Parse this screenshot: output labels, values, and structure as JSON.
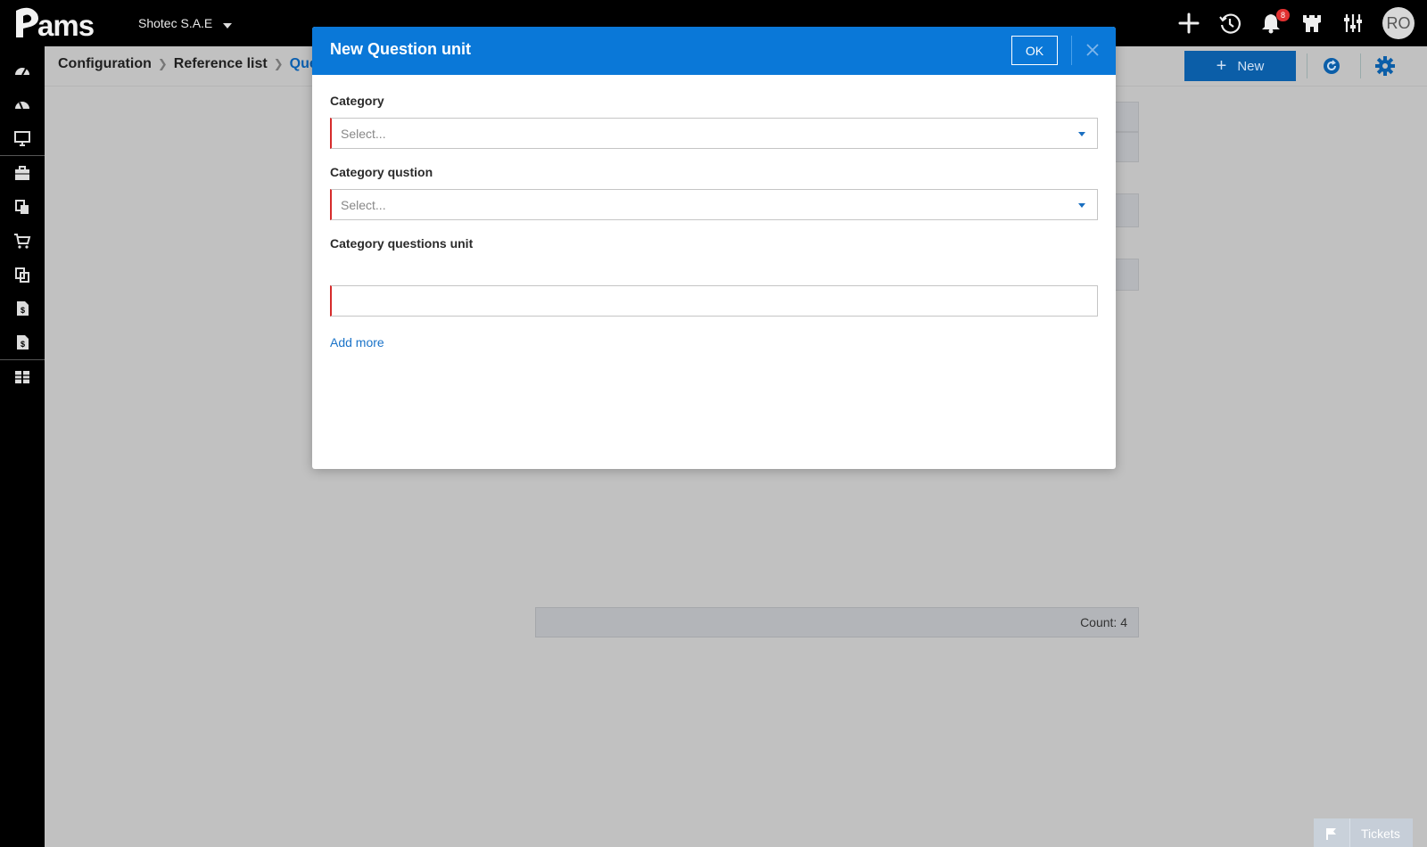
{
  "app": {
    "tenant": "Shotec S.A.E",
    "notification_count": "8",
    "avatar_initials": "RO",
    "accent_color": "#0a78d8"
  },
  "header_icons": [
    "plus-icon",
    "history-icon",
    "bell-icon",
    "castle-icon",
    "sliders-icon"
  ],
  "sidebar": {
    "items": [
      "dashboard-icon",
      "gauge-icon",
      "monitor-icon",
      "briefcase-icon",
      "documents-icon",
      "cart-icon",
      "copy-icon",
      "invoice-icon",
      "invoice-alt-icon",
      "grid-icon"
    ]
  },
  "breadcrumb": {
    "items": [
      "Configuration",
      "Reference list"
    ],
    "current": "Ques"
  },
  "toolbar": {
    "new_label": "New"
  },
  "list": {
    "count_text": "Count: 4"
  },
  "tickets": {
    "label": "Tickets"
  },
  "modal": {
    "title": "New Question unit",
    "ok_label": "OK",
    "fields": {
      "category_label": "Category",
      "category_placeholder": "Select...",
      "category_question_label": "Category qustion",
      "category_question_placeholder": "Select...",
      "unit_label": "Category questions unit",
      "unit_value": ""
    },
    "add_more_label": "Add more"
  }
}
